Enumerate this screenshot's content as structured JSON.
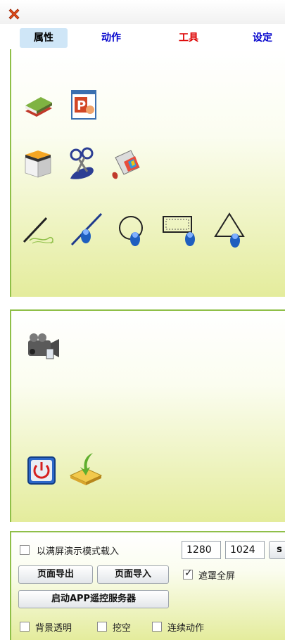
{
  "window": {
    "close_icon": "close-x-icon"
  },
  "tabs": [
    {
      "label": "属性",
      "color": "#000000"
    },
    {
      "label": "动作",
      "color": "#0000cc"
    },
    {
      "label": "工具",
      "color": "#dd0000"
    },
    {
      "label": "设定",
      "color": "#0000cc"
    }
  ],
  "panel1": {
    "icons": [
      "books-icon",
      "powerpoint-icon",
      "box-icon",
      "scissors-icon",
      "paint-bucket-icon",
      "pen-icon",
      "line-tool-icon",
      "circle-tool-icon",
      "rectangle-tool-icon",
      "triangle-tool-icon"
    ]
  },
  "panel2": {
    "icons": [
      "video-camera-icon",
      "power-icon",
      "import-icon"
    ]
  },
  "settings": {
    "fullscreen_label": "以满屏演示模式载入",
    "width": "1280",
    "height": "1024",
    "partial_button": "s",
    "export_button": "页面导出",
    "import_button": "页面导入",
    "mask_label": "遮罩全屏",
    "mask_checked": true,
    "app_button": "启动APP遥控服务器",
    "bg_transparent_label": "背景透明",
    "hollow_label": "挖空",
    "continuous_label": "连续动作"
  }
}
